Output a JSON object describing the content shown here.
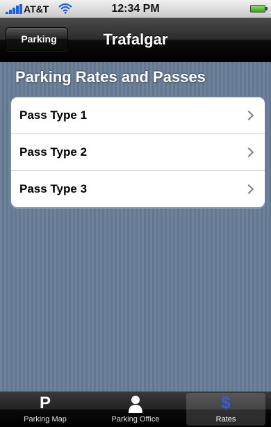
{
  "status_bar": {
    "carrier": "AT&T",
    "time": "12:34 PM"
  },
  "nav": {
    "back_label": "Parking",
    "title": "Trafalgar"
  },
  "section": {
    "title": "Parking Rates and Passes"
  },
  "list": {
    "items": [
      {
        "label": "Pass Type 1"
      },
      {
        "label": "Pass Type 2"
      },
      {
        "label": "Pass Type 3"
      }
    ]
  },
  "tabs": [
    {
      "label": "Parking Map",
      "icon": "P"
    },
    {
      "label": "Parking Office",
      "icon": "person-icon"
    },
    {
      "label": "Rates",
      "icon": "$",
      "active": true
    }
  ],
  "colors": {
    "rates_icon": "#3b5bd8",
    "battery": "#4cc22c"
  }
}
